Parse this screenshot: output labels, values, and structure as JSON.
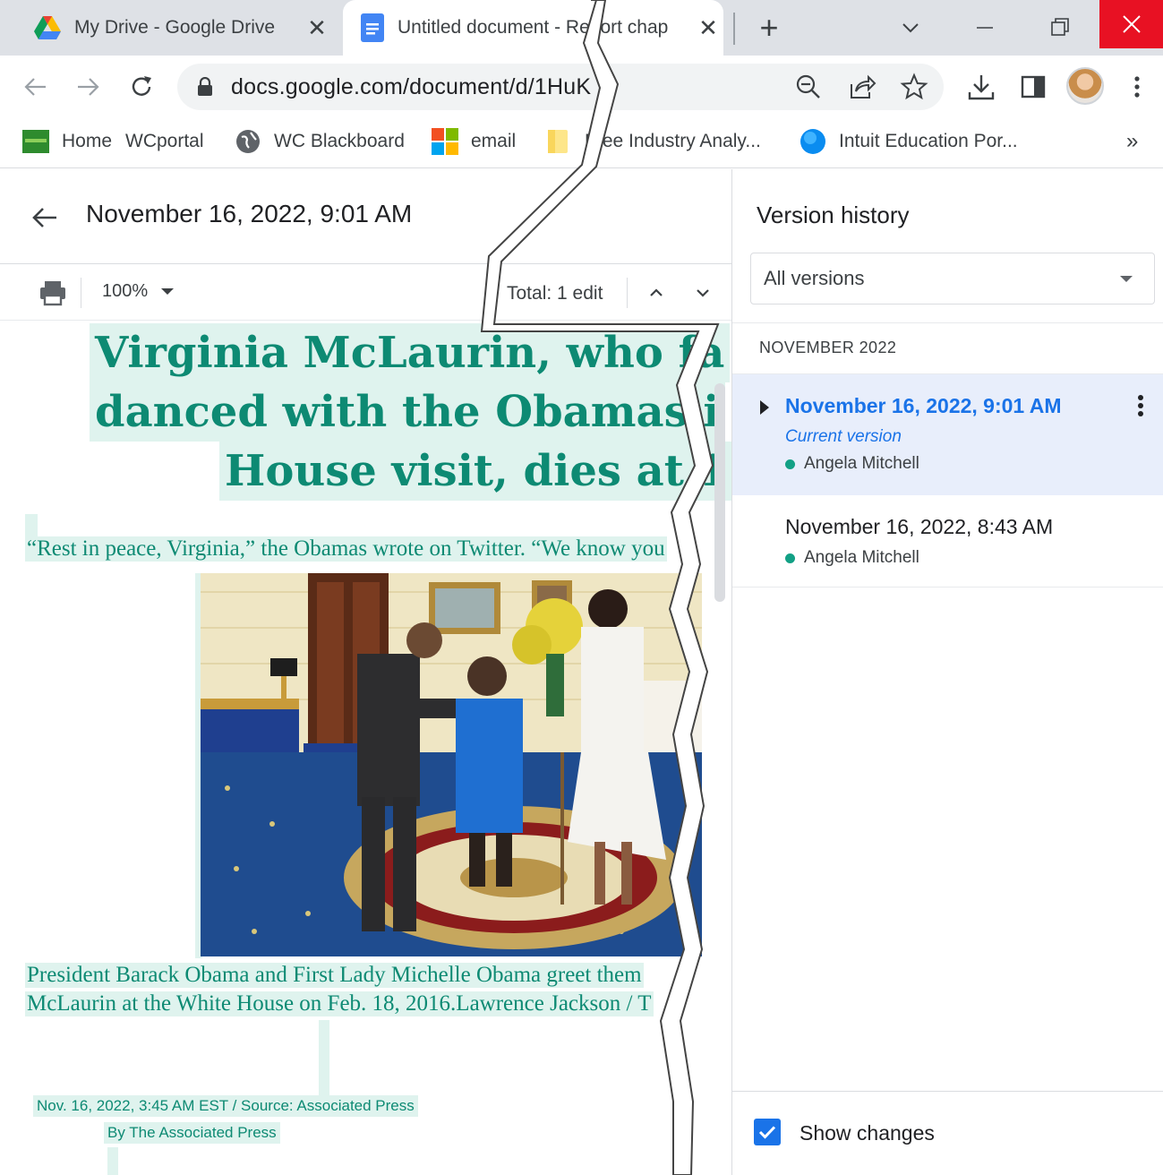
{
  "browser": {
    "tabs": [
      {
        "title": "My Drive - Google Drive",
        "active": false,
        "icon": "google-drive-icon"
      },
      {
        "title": "Untitled document - Report chap",
        "active": true,
        "icon": "google-docs-icon"
      }
    ],
    "url": "docs.google.com/document/d/1HuK",
    "bookmarks": [
      {
        "label": "Home",
        "icon": "bookmark-leaf-icon"
      },
      {
        "label": "WCportal",
        "icon": ""
      },
      {
        "label": "WC Blackboard",
        "icon": "globe-icon"
      },
      {
        "label": "email",
        "icon": "microsoft-icon"
      },
      {
        "label": "Free Industry Analy...",
        "icon": "folder-icon"
      },
      {
        "label": "Intuit Education Por...",
        "icon": "intuit-icon"
      }
    ],
    "more_bookmarks": "»"
  },
  "doc": {
    "version_title": "November 16, 2022, 9:01 AM",
    "zoom": "100%",
    "total_edits": "Total: 1 edit",
    "headline_lines": [
      "Virginia McLaurin, who fa",
      "danced with the Obamas i",
      "House visit, dies at 1"
    ],
    "quote": "“Rest in peace, Virginia,” the Obamas wrote on Twitter. “We know you",
    "photo_alt": "photo",
    "caption_lines": [
      "President Barack Obama and First Lady Michelle Obama greet them",
      "McLaurin at the White House on Feb. 18, 2016.Lawrence Jackson / T"
    ],
    "meta_lines": [
      "Nov. 16, 2022, 3:45 AM EST / Source: Associated Press",
      "By The Associated Press"
    ]
  },
  "panel": {
    "title": "Version history",
    "filter": "All versions",
    "month": "NOVEMBER 2022",
    "versions": [
      {
        "date": "November 16, 2022, 9:01 AM",
        "subtitle": "Current version",
        "author": "Angela Mitchell",
        "selected": true
      },
      {
        "date": "November 16, 2022, 8:43 AM",
        "subtitle": "",
        "author": "Angela Mitchell",
        "selected": false
      }
    ],
    "show_changes_label": "Show changes",
    "show_changes_checked": true
  },
  "colors": {
    "accent": "#1a73e8",
    "highlight_text": "#0d8a73",
    "highlight_bg": "#dff3ee",
    "author_dot": "#12a085",
    "close_red": "#e81123"
  }
}
